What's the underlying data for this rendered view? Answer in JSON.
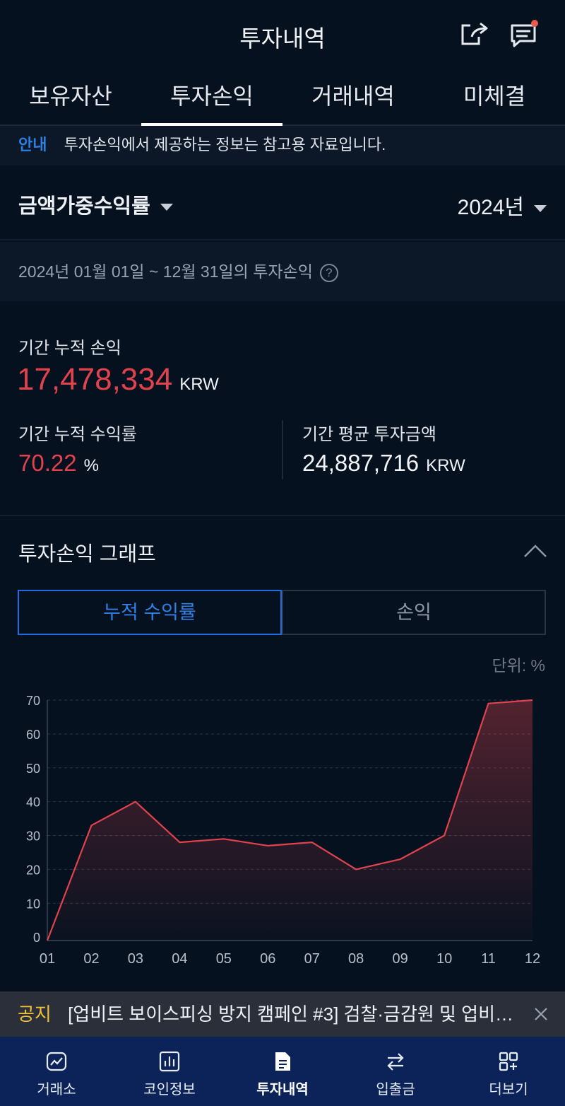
{
  "header": {
    "title": "투자내역"
  },
  "tabs": [
    {
      "label": "보유자산"
    },
    {
      "label": "투자손익"
    },
    {
      "label": "거래내역"
    },
    {
      "label": "미체결"
    }
  ],
  "notice": {
    "tag": "안내",
    "text": "투자손익에서 제공하는 정보는 참고용 자료입니다."
  },
  "selectors": {
    "metric": "금액가중수익률",
    "year": "2024년"
  },
  "period": {
    "text": "2024년 01월 01일 ~ 12월 31일의 투자손익"
  },
  "summary": {
    "cum_pnl_label": "기간 누적 손익",
    "cum_pnl_value": "17,478,334",
    "cum_pnl_unit": "KRW",
    "cum_return_label": "기간 누적 수익률",
    "cum_return_value": "70.22",
    "cum_return_unit": "%",
    "avg_invest_label": "기간 평균 투자금액",
    "avg_invest_value": "24,887,716",
    "avg_invest_unit": "KRW"
  },
  "graph": {
    "title": "투자손익 그래프",
    "toggle": [
      {
        "label": "누적 수익률"
      },
      {
        "label": "손익"
      }
    ],
    "unit_note": "단위: %"
  },
  "chart_data": {
    "type": "area",
    "x": [
      "01",
      "02",
      "03",
      "04",
      "05",
      "06",
      "07",
      "08",
      "09",
      "10",
      "11",
      "12"
    ],
    "series": [
      {
        "values": [
          -1,
          33,
          40,
          28,
          29,
          27,
          28,
          20,
          23,
          30,
          69,
          70
        ]
      }
    ],
    "yticks": [
      0,
      10,
      20,
      30,
      40,
      50,
      60,
      70
    ],
    "ylim": [
      -1,
      70
    ],
    "grid": true,
    "color": "#e0434d"
  },
  "bottom_notice": {
    "tag": "공지",
    "text": "[업비트 보이스피싱 방지 캠페인 #3] 검찰·금감원 및 업비…"
  },
  "nav": [
    {
      "label": "거래소",
      "icon": "chart-icon"
    },
    {
      "label": "코인정보",
      "icon": "bar-chart-icon"
    },
    {
      "label": "투자내역",
      "icon": "document-icon"
    },
    {
      "label": "입출금",
      "icon": "transfer-icon"
    },
    {
      "label": "더보기",
      "icon": "grid-plus-icon"
    }
  ]
}
